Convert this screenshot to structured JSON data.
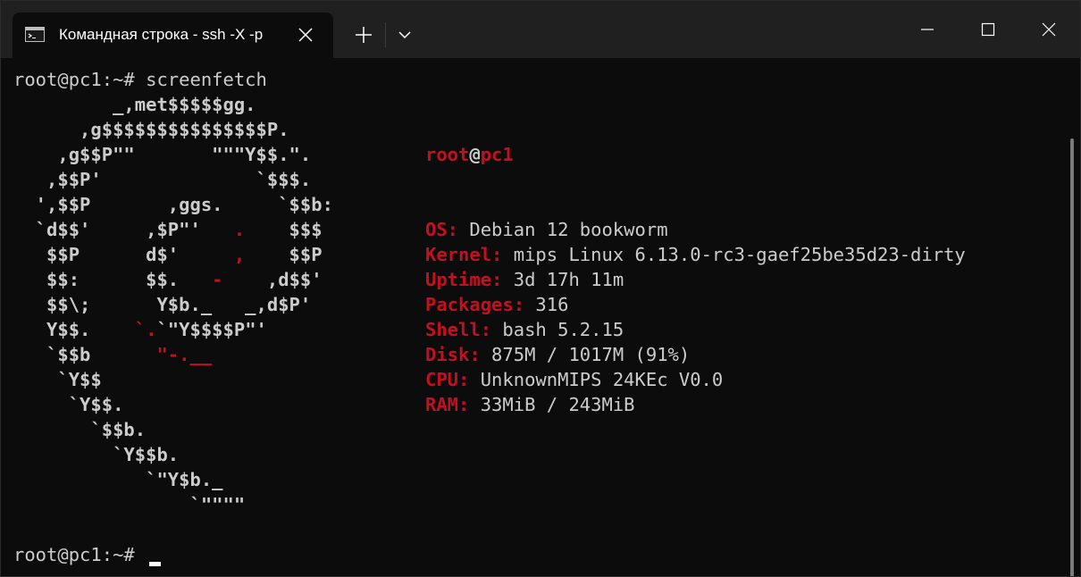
{
  "window": {
    "tab_title": "Командная строка - ssh  -X -p",
    "icons": {
      "tab": "command-prompt-icon",
      "close_tab": "close-icon",
      "new_tab": "plus-icon",
      "dropdown": "chevron-down-icon",
      "minimize": "minimize-icon",
      "maximize": "maximize-icon",
      "close_window": "close-icon"
    }
  },
  "terminal": {
    "prompt1": "root@pc1:~# screenfetch",
    "prompt2": "root@pc1:~# ",
    "ascii_art": [
      [
        {
          "t": "         _,met$$$$$gg.",
          "c": ""
        }
      ],
      [
        {
          "t": "      ,g$$$$$$$$$$$$$$$P.",
          "c": ""
        }
      ],
      [
        {
          "t": "    ,g$$P\"\"       \"\"\"Y$$.\".",
          "c": ""
        }
      ],
      [
        {
          "t": "   ,$$P'              `$$$.",
          "c": ""
        }
      ],
      [
        {
          "t": "  ',$$P       ,ggs.     `$$b:",
          "c": ""
        }
      ],
      [
        {
          "t": "  `d$$'     ,$P\"'   ",
          "c": ""
        },
        {
          "t": ".",
          "c": "r"
        },
        {
          "t": "    $$$",
          "c": ""
        }
      ],
      [
        {
          "t": "   $$P      d$'     ",
          "c": ""
        },
        {
          "t": ",",
          "c": "r"
        },
        {
          "t": "    $$P",
          "c": ""
        }
      ],
      [
        {
          "t": "   $$:      $$.   ",
          "c": ""
        },
        {
          "t": "-",
          "c": "r"
        },
        {
          "t": "    ,d$$'",
          "c": ""
        }
      ],
      [
        {
          "t": "   $$\\;      Y$b._   _,d$P'",
          "c": ""
        }
      ],
      [
        {
          "t": "   Y$$.    ",
          "c": ""
        },
        {
          "t": "`.",
          "c": "r"
        },
        {
          "t": "`\"Y$$$$P\"'",
          "c": ""
        }
      ],
      [
        {
          "t": "   `$$b      ",
          "c": ""
        },
        {
          "t": "\"-.__",
          "c": "r"
        }
      ],
      [
        {
          "t": "    `Y$$",
          "c": ""
        }
      ],
      [
        {
          "t": "     `Y$$.",
          "c": ""
        }
      ],
      [
        {
          "t": "       `$$b.",
          "c": ""
        }
      ],
      [
        {
          "t": "         `Y$$b.",
          "c": ""
        }
      ],
      [
        {
          "t": "            `\"Y$b._",
          "c": ""
        }
      ],
      [
        {
          "t": "                `\"\"\"\"",
          "c": ""
        }
      ]
    ],
    "info": {
      "user": "root",
      "at": "@",
      "host": "pc1",
      "rows": [
        {
          "key": "OS:",
          "value": " Debian 12 bookworm"
        },
        {
          "key": "Kernel:",
          "value": " mips Linux 6.13.0-rc3-gaef25be35d23-dirty"
        },
        {
          "key": "Uptime:",
          "value": " 3d 17h 11m"
        },
        {
          "key": "Packages:",
          "value": " 316"
        },
        {
          "key": "Shell:",
          "value": " bash 5.2.15"
        },
        {
          "key": "Disk:",
          "value": " 875M / 1017M (91%)"
        },
        {
          "key": "CPU:",
          "value": " UnknownMIPS 24KEc V0.0"
        },
        {
          "key": "RAM:",
          "value": " 33MiB / 243MiB"
        }
      ]
    },
    "colors": {
      "accent_red": "#c50f1f",
      "text": "#cccccc",
      "background": "#0c0c0c",
      "titlebar": "#202020"
    }
  }
}
